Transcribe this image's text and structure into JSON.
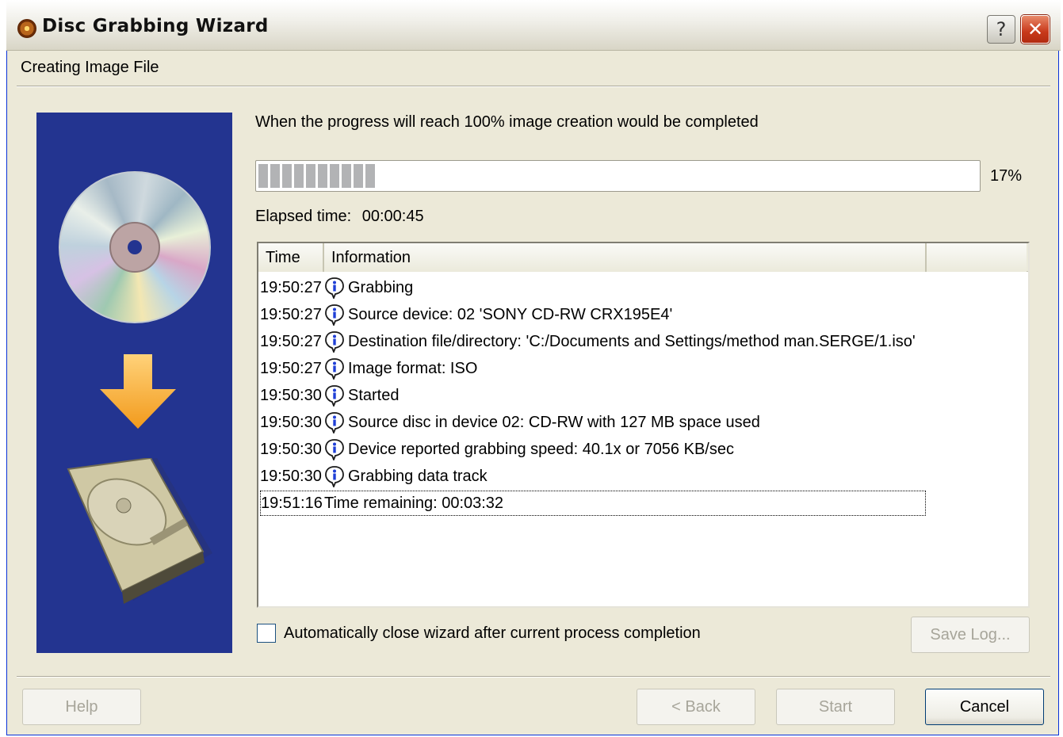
{
  "window": {
    "title": "Disc Grabbing Wizard",
    "help_glyph": "?",
    "close_glyph": "✕"
  },
  "step_title": "Creating Image File",
  "intro_text": "When the progress will reach 100% image creation would be completed",
  "progress": {
    "percent": 17,
    "label": "17%"
  },
  "elapsed": {
    "label": "Elapsed time:",
    "value": "00:00:45"
  },
  "log": {
    "columns": [
      "Time",
      "Information",
      ""
    ],
    "rows": [
      {
        "time": "19:50:27",
        "icon": "info-icon",
        "text": "Grabbing"
      },
      {
        "time": "19:50:27",
        "icon": "info-icon",
        "text": "Source device: 02 'SONY CD-RW  CRX195E4'"
      },
      {
        "time": "19:50:27",
        "icon": "info-icon",
        "text": "Destination file/directory: 'C:/Documents and Settings/method man.SERGE/1.iso'"
      },
      {
        "time": "19:50:27",
        "icon": "info-icon",
        "text": "Image format: ISO"
      },
      {
        "time": "19:50:30",
        "icon": "info-icon",
        "text": "Started"
      },
      {
        "time": "19:50:30",
        "icon": "info-icon",
        "text": "Source disc in device 02: CD-RW with 127 MB space used"
      },
      {
        "time": "19:50:30",
        "icon": "info-icon",
        "text": "Device reported grabbing speed: 40.1x or 7056 KB/sec"
      },
      {
        "time": "19:50:30",
        "icon": "info-icon",
        "text": "Grabbing data track"
      },
      {
        "time": "19:51:16",
        "icon": "",
        "text": "Time remaining: 00:03:32"
      }
    ]
  },
  "auto_close": {
    "label": "Automatically close wizard after current process completion",
    "checked": false
  },
  "buttons": {
    "save_log": "Save Log...",
    "help": "Help",
    "back": "< Back",
    "start": "Start",
    "cancel": "Cancel"
  },
  "colors": {
    "dialog_bg": "#ece9d8",
    "side_panel_bg": "#233490",
    "progress_block": "#b2b3b5",
    "info_icon": "#1f3fd6"
  }
}
